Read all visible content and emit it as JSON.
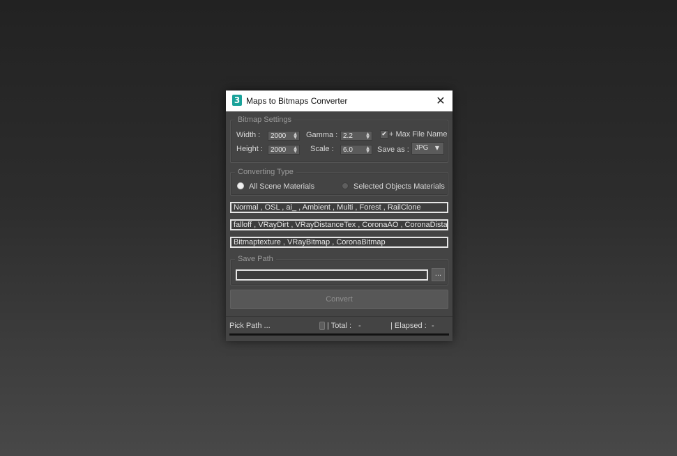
{
  "window": {
    "title": "Maps to Bitmaps Converter",
    "icon": "3ds-max-icon",
    "close_glyph": "✕"
  },
  "bitmap_settings": {
    "title": "Bitmap Settings",
    "width_label": "Width  :",
    "width_value": "2000",
    "height_label": "Height  :",
    "height_value": "2000",
    "gamma_label": "Gamma :",
    "gamma_value": "2.2",
    "scale_label": "Scale  :",
    "scale_value": "6.0",
    "max_file_name_label": "+ Max File Name",
    "max_file_name_checked": true,
    "check_glyph": "✔",
    "save_as_label": "Save as :",
    "save_as_value": "JPG",
    "caret_glyph": "▼"
  },
  "converting_type": {
    "title": "Converting Type",
    "options": [
      {
        "label": "All Scene Materials",
        "selected": true
      },
      {
        "label": "Selected Objects Materials",
        "selected": false
      }
    ]
  },
  "filters": {
    "line1": "Normal , OSL , ai_ , Ambient , Multi , Forest , RailClone",
    "line2": "falloff , VRayDirt , VRayDistanceTex , CoronaAO , CoronaDistance",
    "line3": "Bitmaptexture , VRayBitmap , CoronaBitmap"
  },
  "save_path": {
    "title": "Save Path",
    "value": "",
    "browse_label": "..."
  },
  "convert_label": "Convert",
  "status": {
    "pick_path": "Pick Path ...",
    "total_label": "| Total :",
    "total_value": "-",
    "elapsed_label": "| Elapsed :",
    "elapsed_value": "-",
    "progress": 0
  },
  "colors": {
    "window_bg": "#444444",
    "title_bg": "#ffffff",
    "icon_teal": "#1aa29a",
    "field_bg": "#5b5b5b",
    "textbox_border": "#e6e6e6"
  }
}
